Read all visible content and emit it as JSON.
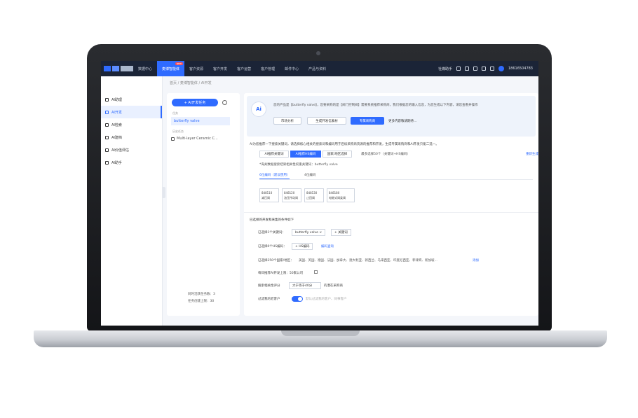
{
  "nav": {
    "items": [
      {
        "label": "数据中心",
        "active": false
      },
      {
        "label": "麦博智能体",
        "active": true,
        "badge": "NEW"
      },
      {
        "label": "客户资源",
        "active": false
      },
      {
        "label": "客户开发",
        "active": false
      },
      {
        "label": "客户运营",
        "active": false
      },
      {
        "label": "客户管理",
        "active": false
      },
      {
        "label": "邮件中心",
        "active": false
      },
      {
        "label": "产品与资料",
        "active": false
      }
    ],
    "assistant": "社媒助手",
    "phone": "18616504783"
  },
  "sidebar": {
    "items": [
      {
        "label": "AI助理",
        "active": false
      },
      {
        "label": "AI开发",
        "active": true
      },
      {
        "label": "AI检索",
        "active": false
      },
      {
        "label": "AI建档",
        "active": false
      },
      {
        "label": "AI价值评估",
        "active": false
      },
      {
        "label": "AI助手",
        "active": false
      }
    ]
  },
  "breadcrumb": "首页 / 麦博智能体 / AI开发",
  "left_panel": {
    "new_task": "+ AI开发任务",
    "section_current": "任务",
    "current_task": "butterfly valve",
    "section_history": "历史任务",
    "history_item": "Multi-layer Ceramic C...",
    "footer_line1": "同时活跃任务数：3",
    "footer_line2": "任务创建上限：30"
  },
  "main": {
    "ai_logo": "Ai",
    "ai_message": "您的产品是【butterfly valve】，您要采购的是【阀门控制阀】需要系统推荐采购商，我们根据您的输入信息，为您生成以下内容，请您查看并操作",
    "actions": [
      "市场分析",
      "生成开发信素材",
      "专属采购商"
    ],
    "more": "更多内容敬请期待...",
    "desc": "AI为您推荐一下搜索关键词，请选择核心相关的搜索词和编码用于后续采购商资源的推荐和开发，生成专属采购商和AI开发只能二选一。",
    "tabs": [
      "AI推荐关键词",
      "AI推荐HS编码",
      "国家/地区选择",
      "最多选择50个（关键词+HS编码）"
    ],
    "regenerate": "重新生成",
    "keyword_line": "*海关数据搜索结果相关性权重关键词：butterfly valve",
    "subtabs": [
      "6位编码（建议使用）",
      "4位编码"
    ],
    "hs_codes": [
      {
        "code": "848110",
        "name": "减压阀"
      },
      {
        "code": "848120",
        "name": "油压传动阀"
      },
      {
        "code": "848130",
        "name": "止回阀"
      },
      {
        "code": "848180",
        "name": "电磁式阀类阀"
      }
    ],
    "selected_title": "已选择的开发和采集的条件如下",
    "kw_label": "已选择1个关键词：",
    "kw_chip": "butterfly valve ×",
    "kw_add": "+ 关键词",
    "hs_label": "已选择0个HS编码：",
    "hs_add": "+ HS编码",
    "hs_link": "编码查询",
    "regions_label": "已选择250个国家/地区：",
    "regions": "美国、英国、德国、法国、加拿大、澳大利亚、新西兰、马来西亚、印度尼西亚、菲律宾、新加坡...",
    "regions_link": "添加",
    "daily_label": "每日推荐AI开发上限：50家公司",
    "score_label": "搜索相关性评分",
    "score_select": "大于等于40分",
    "score_suffix": "的潜在采购商",
    "filter_label": "过滤我的老客户",
    "filter_hint": "默认过滤我的客户、同事客户"
  }
}
